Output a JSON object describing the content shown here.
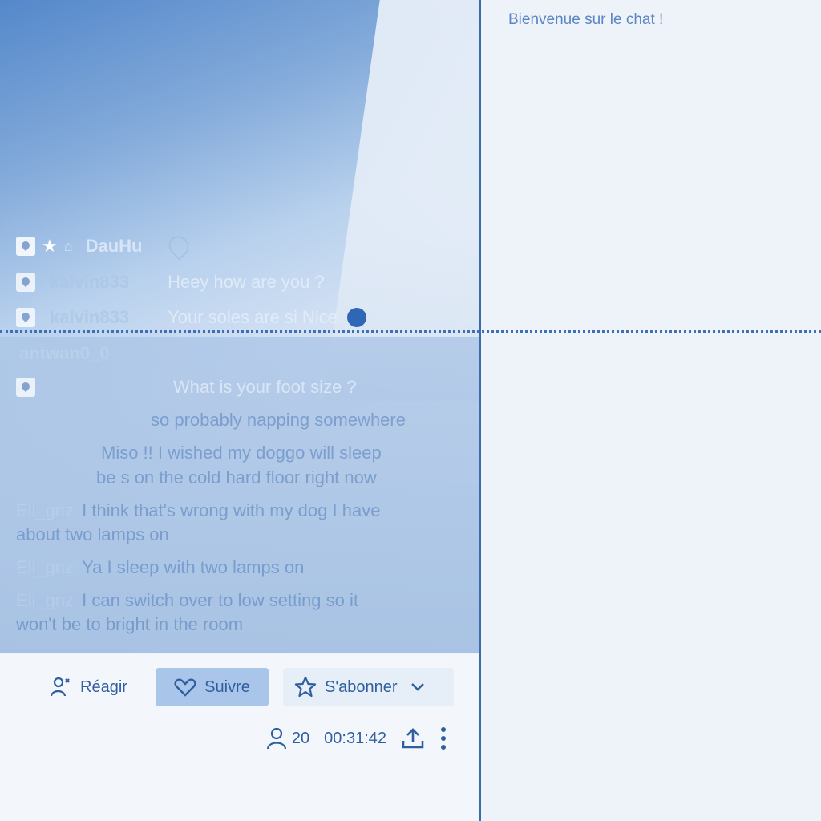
{
  "chat": {
    "welcome": "Bienvenue sur le chat !",
    "overlay": {
      "messages": [
        {
          "user": "DauHu",
          "text": ""
        },
        {
          "user": "kalvin833",
          "text": "Heey how are you ?"
        },
        {
          "user": "kalvin833",
          "text": "Your soles are si Nice"
        },
        {
          "user": "antwan0_0",
          "text": ""
        },
        {
          "user": "",
          "text": "What is your foot size ?"
        },
        {
          "user": "",
          "text": "so probably napping somewhere"
        },
        {
          "user": "",
          "text": "Miso !! I wished my doggo will sleep"
        },
        {
          "user": "",
          "text": "be s on the cold hard floor right now"
        },
        {
          "user": "Eli_gnz",
          "text": "I think that's wrong with my dog I have"
        },
        {
          "user": "",
          "text": "about two lamps on"
        },
        {
          "user": "Eli_gnz",
          "text": "Ya I sleep with two lamps on"
        },
        {
          "user": "Eli_gnz",
          "text": "I can switch over to low setting so it"
        },
        {
          "user": "",
          "text": "won't be to bright in the room"
        }
      ]
    }
  },
  "actions": {
    "react_label": "Réagir",
    "follow_label": "Suivre",
    "subscribe_label": "S'abonner"
  },
  "stats": {
    "viewers": "20",
    "duration": "00:31:42"
  },
  "icons": {
    "react": "react-person-icon",
    "follow": "heart-icon",
    "subscribe": "star-icon",
    "dropdown": "chevron-down-icon",
    "viewers": "user-icon",
    "share": "share-upload-icon",
    "more": "more-vertical-icon"
  },
  "colors": {
    "accent": "#2f5f9f",
    "follow_bg": "#a9c5ea",
    "background": "#eef3fa"
  }
}
